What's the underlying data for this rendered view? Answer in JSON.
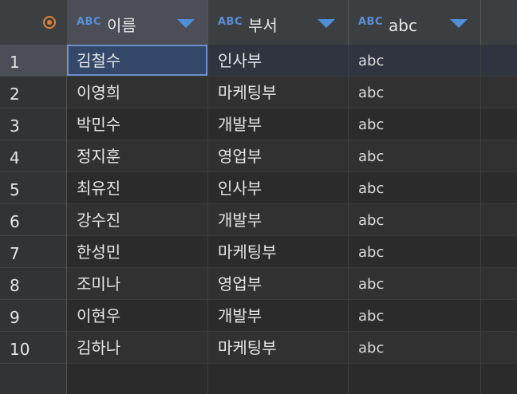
{
  "columns": [
    {
      "type_tag": "ABC",
      "title": "이름"
    },
    {
      "type_tag": "ABC",
      "title": "부서"
    },
    {
      "type_tag": "ABC",
      "title": "abc"
    }
  ],
  "rows": [
    {
      "num": "1",
      "name": "김철수",
      "dept": "인사부",
      "abc": "abc"
    },
    {
      "num": "2",
      "name": "이영희",
      "dept": "마케팅부",
      "abc": "abc"
    },
    {
      "num": "3",
      "name": "박민수",
      "dept": "개발부",
      "abc": "abc"
    },
    {
      "num": "4",
      "name": "정지훈",
      "dept": "영업부",
      "abc": "abc"
    },
    {
      "num": "5",
      "name": "최유진",
      "dept": "인사부",
      "abc": "abc"
    },
    {
      "num": "6",
      "name": "강수진",
      "dept": "개발부",
      "abc": "abc"
    },
    {
      "num": "7",
      "name": "한성민",
      "dept": "마케팅부",
      "abc": "abc"
    },
    {
      "num": "8",
      "name": "조미나",
      "dept": "영업부",
      "abc": "abc"
    },
    {
      "num": "9",
      "name": "이현우",
      "dept": "개발부",
      "abc": "abc"
    },
    {
      "num": "10",
      "name": "김하나",
      "dept": "마케팅부",
      "abc": "abc"
    }
  ],
  "colors": {
    "accent": "#4f8fd8",
    "corner_icon": "#e0813b",
    "focused_cell": "#34486a"
  }
}
